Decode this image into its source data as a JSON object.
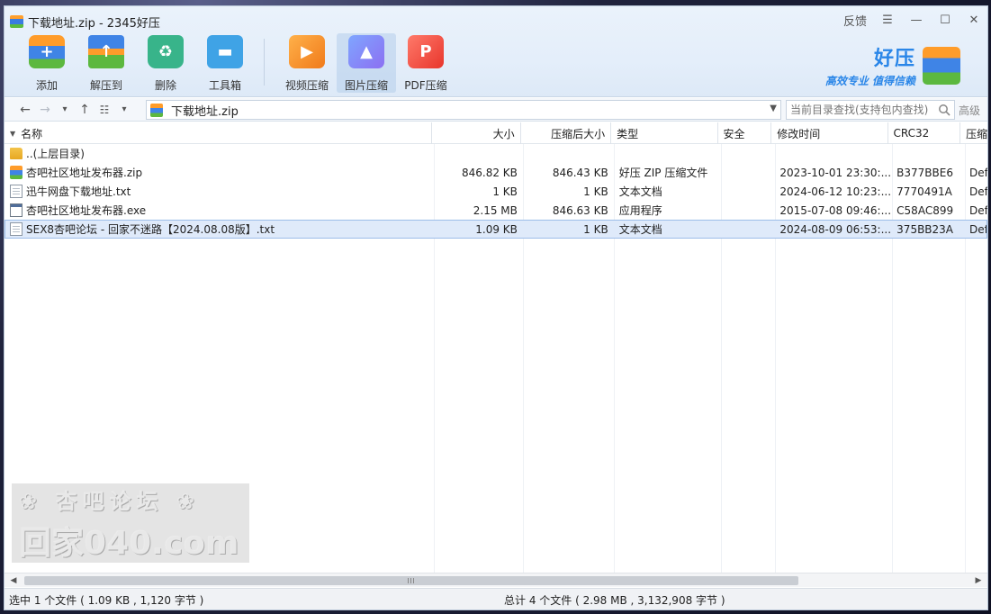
{
  "window": {
    "title": "下载地址.zip - 2345好压",
    "feedback": "反馈"
  },
  "toolbar": {
    "items": [
      {
        "label": "添加",
        "icon": "add-archive-icon"
      },
      {
        "label": "解压到",
        "icon": "extract-icon"
      },
      {
        "label": "删除",
        "icon": "recycle-bin-icon"
      },
      {
        "label": "工具箱",
        "icon": "toolbox-icon"
      },
      {
        "label": "视频压缩",
        "icon": "video-compress-icon"
      },
      {
        "label": "图片压缩",
        "icon": "image-compress-icon"
      },
      {
        "label": "PDF压缩",
        "icon": "pdf-compress-icon"
      }
    ]
  },
  "brand": {
    "name": "好压",
    "slogan": "高效专业  值得信赖"
  },
  "address": {
    "path": "下载地址.zip",
    "search_placeholder": "当前目录查找(支持包内查找)",
    "advanced": "高级"
  },
  "columns": {
    "name": "名称",
    "size": "大小",
    "packed": "压缩后大小",
    "type": "类型",
    "security": "安全",
    "modified": "修改时间",
    "crc": "CRC32",
    "method": "压缩"
  },
  "rows": [
    {
      "name": "..(上层目录)",
      "size": "",
      "packed": "",
      "type": "",
      "security": "",
      "modified": "",
      "crc": "",
      "method": "",
      "kind": "folder"
    },
    {
      "name": "杏吧社区地址发布器.zip",
      "size": "846.82 KB",
      "packed": "846.43 KB",
      "type": "好压 ZIP 压缩文件",
      "security": "",
      "modified": "2023-10-01 23:30:...",
      "crc": "B377BBE6",
      "method": "Def",
      "kind": "zip"
    },
    {
      "name": "迅牛网盘下载地址.txt",
      "size": "1 KB",
      "packed": "1 KB",
      "type": "文本文档",
      "security": "",
      "modified": "2024-06-12 10:23:...",
      "crc": "7770491A",
      "method": "Def",
      "kind": "txt"
    },
    {
      "name": "杏吧社区地址发布器.exe",
      "size": "2.15 MB",
      "packed": "846.63 KB",
      "type": "应用程序",
      "security": "",
      "modified": "2015-07-08 09:46:...",
      "crc": "C58AC899",
      "method": "Def",
      "kind": "exe"
    },
    {
      "name": "SEX8杏吧论坛 - 回家不迷路【2024.08.08版】.txt",
      "size": "1.09 KB",
      "packed": "1 KB",
      "type": "文本文档",
      "security": "",
      "modified": "2024-08-09 06:53:...",
      "crc": "375BB23A",
      "method": "Def",
      "kind": "txt",
      "selected": true
    }
  ],
  "status": {
    "selected": "选中 1 个文件 ( 1.09 KB , 1,120 字节 )",
    "total": "总计 4 个文件 ( 2.98 MB , 3,132,908 字节 )"
  },
  "colors": {
    "accent": "#2a86e8",
    "selection": "#dfeafa"
  }
}
